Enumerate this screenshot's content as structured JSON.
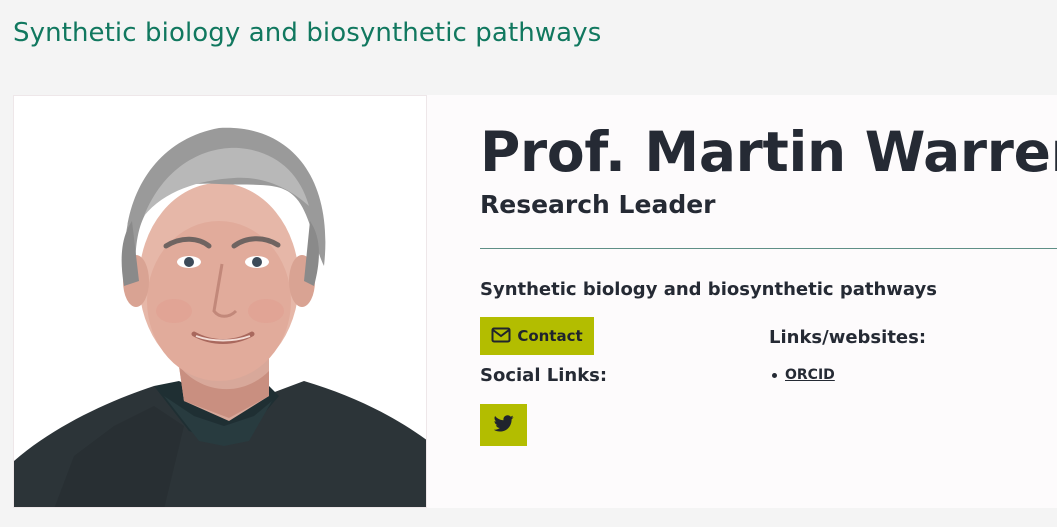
{
  "section": {
    "title": "Synthetic biology and biosynthetic pathways"
  },
  "profile": {
    "name": "Prof. Martin Warren",
    "role": "Research Leader",
    "group": "Synthetic biology and biosynthetic pathways",
    "photo_icon": "portrait-photo"
  },
  "actions": {
    "contact_label": "Contact",
    "contact_icon": "envelope-icon"
  },
  "social": {
    "heading": "Social Links:",
    "items": [
      {
        "icon": "twitter-icon"
      }
    ]
  },
  "links": {
    "heading": "Links/websites:",
    "items": [
      {
        "label": "ORCID"
      }
    ]
  },
  "colors": {
    "accent": "#11785f",
    "button": "#b3bd00",
    "text": "#252a34",
    "divider": "#5f8f86"
  }
}
